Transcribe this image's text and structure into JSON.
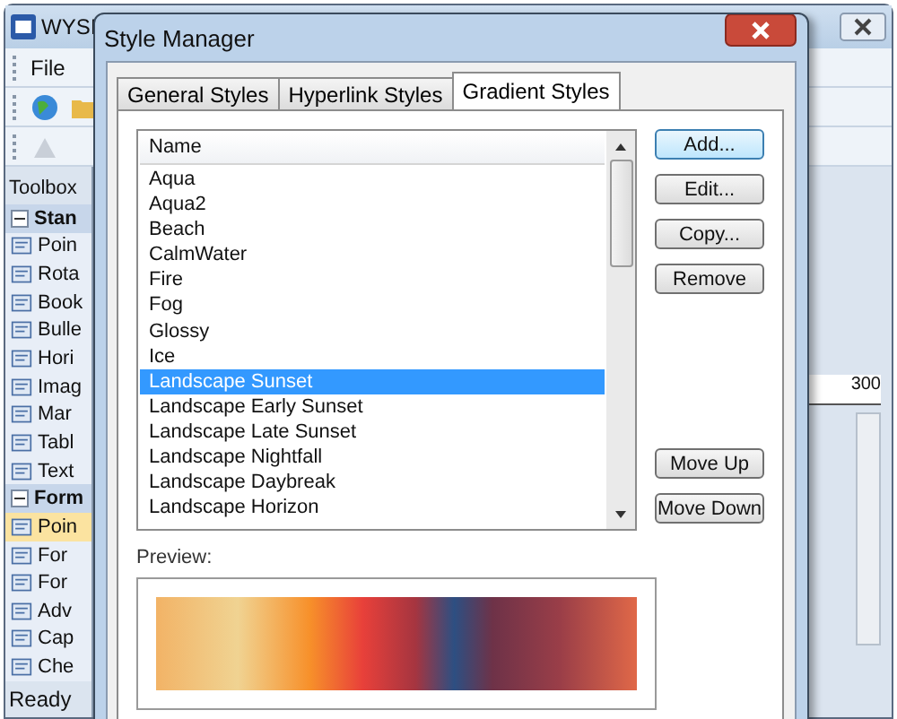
{
  "app": {
    "title": "WYSI",
    "menu": [
      "File"
    ],
    "toolbox_title": "Toolbox",
    "toolbox": [
      {
        "label": "Stan",
        "expanded": true,
        "children": [
          {
            "label": "Poin",
            "selected": false
          },
          {
            "label": "Rota",
            "selected": false
          },
          {
            "label": "Book",
            "selected": false
          },
          {
            "label": "Bulle",
            "selected": false
          },
          {
            "label": "Hori",
            "selected": false
          },
          {
            "label": "Imag",
            "selected": false
          },
          {
            "label": "Mar",
            "selected": false
          },
          {
            "label": "Tabl",
            "selected": false
          },
          {
            "label": "Text",
            "selected": false
          }
        ]
      },
      {
        "label": "Form",
        "expanded": true,
        "children": [
          {
            "label": "Poin",
            "selected": true
          },
          {
            "label": "For",
            "selected": false
          },
          {
            "label": "For",
            "selected": false
          },
          {
            "label": "Adv",
            "selected": false
          },
          {
            "label": "Cap",
            "selected": false
          },
          {
            "label": "Che",
            "selected": false
          }
        ]
      }
    ],
    "ruler": "300",
    "status": "Ready"
  },
  "dialog": {
    "title": "Style Manager",
    "tabs": [
      {
        "label": "General Styles",
        "selected": false
      },
      {
        "label": "Hyperlink Styles",
        "selected": false
      },
      {
        "label": "Gradient Styles",
        "selected": true
      }
    ],
    "list": {
      "header": "Name",
      "rows": [
        {
          "name": "Aqua",
          "selected": false
        },
        {
          "name": "Aqua2",
          "selected": false
        },
        {
          "name": "Beach",
          "selected": false
        },
        {
          "name": "CalmWater",
          "selected": false
        },
        {
          "name": "Fire",
          "selected": false
        },
        {
          "name": "Fog",
          "selected": false
        },
        {
          "name": "Glossy",
          "selected": false
        },
        {
          "name": "Ice",
          "selected": false
        },
        {
          "name": "Landscape Sunset",
          "selected": true
        },
        {
          "name": "Landscape Early Sunset",
          "selected": false
        },
        {
          "name": "Landscape Late Sunset",
          "selected": false
        },
        {
          "name": "Landscape Nightfall",
          "selected": false
        },
        {
          "name": "Landscape Daybreak",
          "selected": false
        },
        {
          "name": "Landscape Horizon",
          "selected": false
        }
      ]
    },
    "buttons_top": [
      {
        "label": "Add...",
        "default": true
      },
      {
        "label": "Edit...",
        "default": false
      },
      {
        "label": "Copy...",
        "default": false
      },
      {
        "label": "Remove",
        "default": false
      }
    ],
    "buttons_bottom": [
      {
        "label": "Move Up",
        "default": false
      },
      {
        "label": "Move Down",
        "default": false
      }
    ],
    "preview_label": "Preview:"
  }
}
